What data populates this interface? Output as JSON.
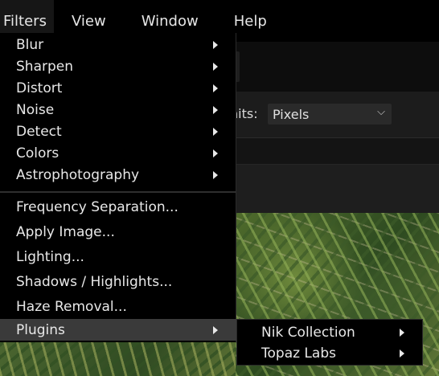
{
  "menubar": {
    "items": [
      {
        "label": "Filters"
      },
      {
        "label": "View"
      },
      {
        "label": "Window"
      },
      {
        "label": "Help"
      }
    ]
  },
  "context_toolbar": {
    "units_label": "nits:",
    "units_value": "Pixels"
  },
  "filters_menu": {
    "items": [
      {
        "label": "Blur",
        "has_submenu": true
      },
      {
        "label": "Sharpen",
        "has_submenu": true
      },
      {
        "label": "Distort",
        "has_submenu": true
      },
      {
        "label": "Noise",
        "has_submenu": true
      },
      {
        "label": "Detect",
        "has_submenu": true
      },
      {
        "label": "Colors",
        "has_submenu": true
      },
      {
        "label": "Astrophotography",
        "has_submenu": true
      },
      {
        "label": "Frequency Separation...",
        "has_submenu": false
      },
      {
        "label": "Apply Image...",
        "has_submenu": false
      },
      {
        "label": "Lighting...",
        "has_submenu": false
      },
      {
        "label": "Shadows / Highlights...",
        "has_submenu": false
      },
      {
        "label": "Haze Removal...",
        "has_submenu": false
      },
      {
        "label": "Plugins",
        "has_submenu": true,
        "highlighted": true
      }
    ]
  },
  "plugins_submenu": {
    "items": [
      {
        "label": "Nik Collection",
        "has_submenu": true
      },
      {
        "label": "Topaz Labs",
        "has_submenu": true
      }
    ]
  },
  "colors": {
    "menu_bg": "#000000",
    "menu_text": "#e8e8e8",
    "highlight_bg": "#3a3a3a",
    "app_bg": "#161616"
  }
}
